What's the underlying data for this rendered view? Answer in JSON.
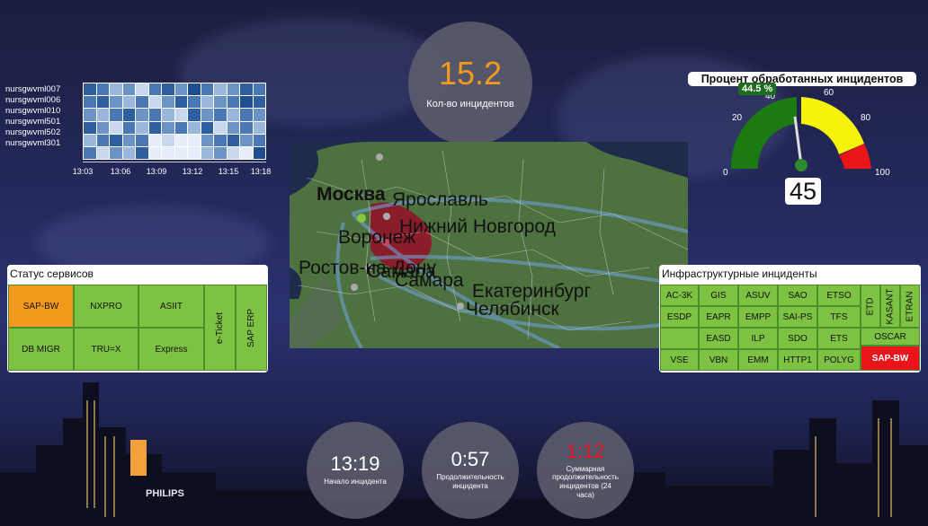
{
  "kpi": {
    "value": "15.2",
    "label": "Кол-во инцидентов"
  },
  "heatmap": {
    "rows": [
      "nursgwvml007",
      "nursgwvml006",
      "nursgwvml010",
      "nursgwvml501",
      "nursgwvml502",
      "nursgwvml301"
    ],
    "times": [
      "13:03",
      "13:06",
      "13:09",
      "13:12",
      "13:15",
      "13:18"
    ],
    "colors": [
      "#2f5f9e",
      "#4a78b4",
      "#6b93c6",
      "#9bb7dc",
      "#c9d8ee",
      "#1f4f8f",
      "#e6eef9"
    ]
  },
  "gauge": {
    "title": "Процент обработанных инцидентов",
    "percent_label": "44.5 %",
    "value": "45",
    "ticks": [
      "0",
      "20",
      "40",
      "60",
      "80",
      "100"
    ],
    "min": 0,
    "max": 100,
    "reading": 45,
    "colors": {
      "green": "#1b7a12",
      "yellow": "#f7f20a",
      "red": "#e8151b"
    }
  },
  "map": {
    "cities": [
      "Москва",
      "Ярославль",
      "Нижний Новгород",
      "Воронеж",
      "Ростов-на-Дону",
      "Самара",
      "Самара",
      "Екатеринбург",
      "Челябинск"
    ]
  },
  "services": {
    "title": "Статус сервисов",
    "cells": [
      "SAP-BW",
      "NXPRO",
      "ASIIT",
      "e-Ticket",
      "SAP ERP",
      "DB MIGR",
      "TRU=X",
      "Express"
    ]
  },
  "infra": {
    "title": "Инфраструктурные инциденты",
    "cells": [
      "AC-3K",
      "GIS",
      "ASUV",
      "SAO",
      "ETSO",
      "ETD",
      "KASANT",
      "ETRAN",
      "ESDP",
      "EAPR",
      "EMPP",
      "SAI-PS",
      "TFS",
      "EASD",
      "ILP",
      "SDO",
      "ETS",
      "OSCAR",
      "VSE",
      "VBN",
      "EMM",
      "HTTP1",
      "POLYG",
      "SAP-BW"
    ]
  },
  "bottom": {
    "start_time": "13:19",
    "start_label": "Начало инцидента",
    "duration": "0:57",
    "duration_label": "Продолжительность инцидента",
    "total": "1:12",
    "total_label": "Суммарная продолжительность инцидентов (24 часа)",
    "total_color": "#e8151b"
  },
  "skyline": {
    "brand": "PHILIPS"
  }
}
